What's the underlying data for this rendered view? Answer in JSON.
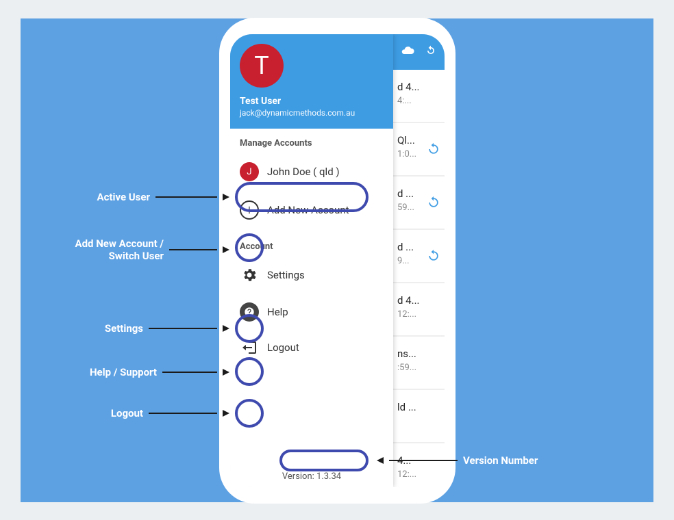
{
  "drawer": {
    "user_initial": "T",
    "user_name": "Test User",
    "user_email": "jack@dynamicmethods.com.au",
    "section_manage": "Manage Accounts",
    "active_user_initial": "J",
    "active_user_label": "John Doe ( qld )",
    "add_account_label": "Add New Account",
    "section_account": "Account",
    "settings_label": "Settings",
    "help_label": "Help",
    "logout_label": "Logout",
    "version_label": "Version: 1.3.34"
  },
  "bg_rows": [
    {
      "title": "d 4...",
      "sub": "4:..."
    },
    {
      "title": "Ql...",
      "sub": "1:0...",
      "refresh": true
    },
    {
      "title": "d ...",
      "sub": "59...",
      "refresh": true
    },
    {
      "title": "d ...",
      "sub": "9...",
      "refresh": true
    },
    {
      "title": "d 4...",
      "sub": "12:..."
    },
    {
      "title": "ns...",
      "sub": ":59..."
    },
    {
      "title": "ld ...",
      "sub": ""
    },
    {
      "title": "4...",
      "sub": "12:..."
    }
  ],
  "annotations": {
    "active_user": "Active User",
    "add_account": "Add New Account /\nSwitch User",
    "settings": "Settings",
    "help": "Help / Support",
    "logout": "Logout",
    "version": "Version Number"
  }
}
